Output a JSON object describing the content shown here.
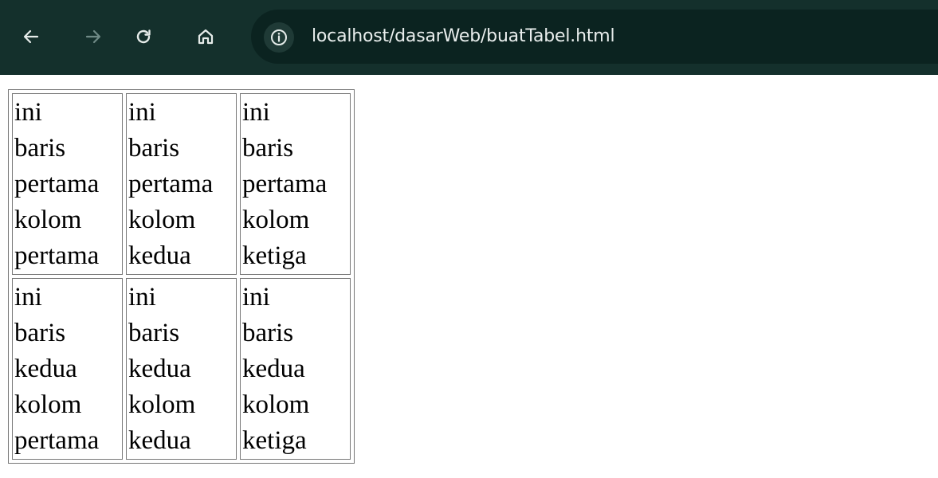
{
  "browser": {
    "url": "localhost/dasarWeb/buatTabel.html",
    "theme_color": "#14302c",
    "address_bar_color": "#0b2320"
  },
  "table": {
    "rows": [
      [
        [
          "ini",
          "baris",
          "pertama",
          "kolom",
          "pertama"
        ],
        [
          "ini",
          "baris",
          "pertama",
          "kolom",
          "kedua"
        ],
        [
          "ini",
          "baris",
          "pertama",
          "kolom",
          "ketiga"
        ]
      ],
      [
        [
          "ini",
          "baris",
          "kedua",
          "kolom",
          "pertama"
        ],
        [
          "ini",
          "baris",
          "kedua",
          "kolom",
          "kedua"
        ],
        [
          "ini",
          "baris",
          "kedua",
          "kolom",
          "ketiga"
        ]
      ]
    ]
  }
}
